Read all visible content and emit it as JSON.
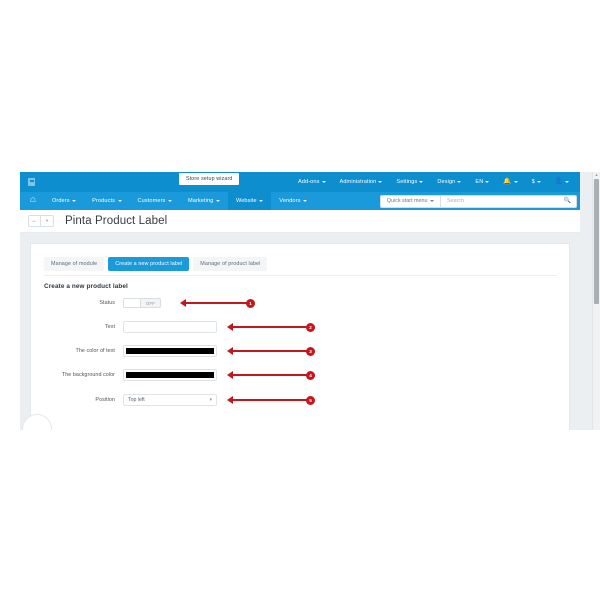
{
  "topbar": {
    "logo_icon": "store-logo-icon",
    "setup_wizard_label": "Store setup wizard",
    "menus": [
      {
        "label": "Add-ons",
        "caret": true
      },
      {
        "label": "Administration",
        "caret": true
      },
      {
        "label": "Settings",
        "caret": true
      },
      {
        "label": "Design",
        "caret": true
      },
      {
        "label": "EN",
        "caret": true
      }
    ],
    "notifications_icon": "bell-icon",
    "currency_label": "$",
    "account_icon": "user-icon"
  },
  "navbar": {
    "home_icon": "home-icon",
    "items": [
      {
        "label": "Orders",
        "active": false
      },
      {
        "label": "Products",
        "active": false
      },
      {
        "label": "Customers",
        "active": false
      },
      {
        "label": "Marketing",
        "active": false
      },
      {
        "label": "Website",
        "active": true
      },
      {
        "label": "Vendors",
        "active": false
      }
    ],
    "quick_start_label": "Quick start menu",
    "search_placeholder": "Search",
    "search_icon": "search-icon"
  },
  "titlebar": {
    "back_icon": "arrow-left-icon",
    "dropdown_icon": "chevron-down-icon",
    "title": "Pinta Product Label"
  },
  "tabs": [
    {
      "label": "Manage of module",
      "active": false
    },
    {
      "label": "Create a new product label",
      "active": true
    },
    {
      "label": "Manage of product label",
      "active": false
    }
  ],
  "form": {
    "heading": "Create a new product label",
    "fields": [
      {
        "label": "Status",
        "type": "toggle",
        "value": "OFF",
        "annotation": "1"
      },
      {
        "label": "Text",
        "type": "text",
        "value": "",
        "placeholder": "",
        "annotation": "2"
      },
      {
        "label": "The color of text",
        "type": "color",
        "value": "#000000",
        "annotation": "3"
      },
      {
        "label": "The background color",
        "type": "color",
        "value": "#000000",
        "annotation": "4"
      },
      {
        "label": "Position",
        "type": "select",
        "value": "Top left",
        "chevron_icon": "chevron-down-icon",
        "annotation": "5"
      }
    ]
  },
  "colors": {
    "header_blue": "#0d8ecf",
    "nav_blue": "#1a9ada",
    "annotation_red": "#c4161c",
    "page_bg": "#eceff1"
  },
  "scrollbar": {
    "up_arrow_icon": "chevron-up-icon"
  },
  "chat_widget": {
    "icon": "chat-bubble-icon"
  }
}
